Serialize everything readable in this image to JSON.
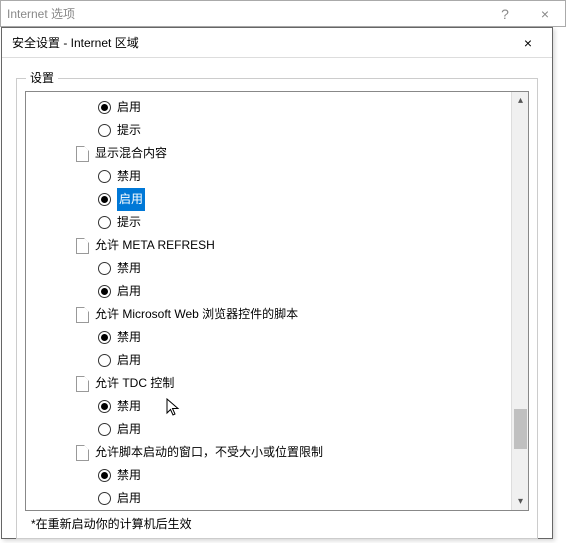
{
  "parent": {
    "title": "Internet 选项",
    "help": "?",
    "close": "×"
  },
  "dialog": {
    "title": "安全设置 - Internet 区域",
    "close": "×",
    "section_label": "设置",
    "footnote": "*在重新启动你的计算机后生效"
  },
  "items": [
    {
      "type": "option",
      "label": "启用",
      "checked": true,
      "selected": false
    },
    {
      "type": "option",
      "label": "提示",
      "checked": false,
      "selected": false
    },
    {
      "type": "category",
      "label": "显示混合内容"
    },
    {
      "type": "option",
      "label": "禁用",
      "checked": false,
      "selected": false
    },
    {
      "type": "option",
      "label": "启用",
      "checked": true,
      "selected": true
    },
    {
      "type": "option",
      "label": "提示",
      "checked": false,
      "selected": false
    },
    {
      "type": "category",
      "label": "允许 META REFRESH"
    },
    {
      "type": "option",
      "label": "禁用",
      "checked": false,
      "selected": false
    },
    {
      "type": "option",
      "label": "启用",
      "checked": true,
      "selected": false
    },
    {
      "type": "category",
      "label": "允许 Microsoft Web 浏览器控件的脚本"
    },
    {
      "type": "option",
      "label": "禁用",
      "checked": true,
      "selected": false
    },
    {
      "type": "option",
      "label": "启用",
      "checked": false,
      "selected": false
    },
    {
      "type": "category",
      "label": "允许 TDC 控制"
    },
    {
      "type": "option",
      "label": "禁用",
      "checked": true,
      "selected": false
    },
    {
      "type": "option",
      "label": "启用",
      "checked": false,
      "selected": false
    },
    {
      "type": "category",
      "label": "允许脚本启动的窗口，不受大小或位置限制"
    },
    {
      "type": "option",
      "label": "禁用",
      "checked": true,
      "selected": false
    },
    {
      "type": "option",
      "label": "启用",
      "checked": false,
      "selected": false
    }
  ]
}
